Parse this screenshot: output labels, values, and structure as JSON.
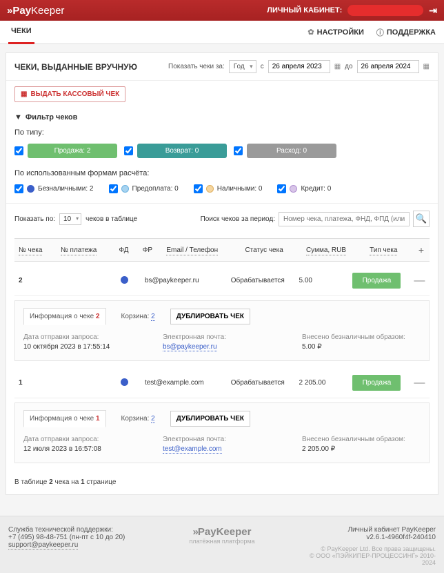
{
  "header": {
    "brand_pay": "Pay",
    "brand_keeper": "Keeper",
    "cabinet_label": "ЛИЧНЫЙ КАБИНЕТ:"
  },
  "nav": {
    "active_tab": "ЧЕКИ",
    "settings": "НАСТРОЙКИ",
    "support": "ПОДДЕРЖКА"
  },
  "titlebar": {
    "title": "ЧЕКИ, ВЫДАННЫЕ ВРУЧНУЮ",
    "show_label": "Показать чеки за:",
    "period": "Год",
    "from_label": "с",
    "from_date": "26 апреля 2023",
    "to_label": "до",
    "to_date": "26 апреля 2024"
  },
  "actions": {
    "issue": "ВЫДАТЬ КАССОВЫЙ ЧЕК"
  },
  "filter": {
    "heading": "Фильтр чеков",
    "by_type": "По типу:",
    "types": [
      {
        "label": "Продажа: 2",
        "cls": "green"
      },
      {
        "label": "Возврат: 0",
        "cls": "teal"
      },
      {
        "label": "Расход: 0",
        "cls": "gray"
      }
    ],
    "by_payment": "По использованным формам расчёта:",
    "payments": [
      {
        "label": "Безналичными: 2",
        "dot": "blue"
      },
      {
        "label": "Предоплата: 0",
        "dot": "lblue"
      },
      {
        "label": "Наличными: 0",
        "dot": "lorange"
      },
      {
        "label": "Кредит: 0",
        "dot": "lpurple"
      }
    ]
  },
  "controls": {
    "show_by": "Показать по:",
    "per_page": "10",
    "in_table": "чеков в таблице",
    "search_label": "Поиск чеков за период:",
    "search_placeholder": "Номер чека, платежа, ФНД, ФПД (или email)"
  },
  "table": {
    "headers": {
      "num": "№ чека",
      "pay": "№ платежа",
      "fd": "ФД",
      "fr": "ФР",
      "email": "Email / Телефон",
      "status": "Статус чека",
      "sum": "Сумма, RUB",
      "type": "Тип чека"
    },
    "rows": [
      {
        "num": "2",
        "email": "bs@paykeeper.ru",
        "status": "Обрабатывается",
        "sum": "5.00",
        "type": "Продажа"
      },
      {
        "num": "1",
        "email": "test@example.com",
        "status": "Обрабатывается",
        "sum": "2 205.00",
        "type": "Продажа"
      }
    ]
  },
  "details": [
    {
      "tab_info": "Информация о чеке",
      "tab_num": "2",
      "tab_cart": "Корзина:",
      "tab_cart_n": "2",
      "dup": "ДУБЛИРОВАТЬ ЧЕК",
      "sent_label": "Дата отправки запроса:",
      "sent_value": "10 октября 2023 в 17:55:14",
      "email_label": "Электронная почта:",
      "email_value": "bs@paykeeper.ru",
      "paid_label": "Внесено безналичным образом:",
      "paid_value": "5.00 ₽"
    },
    {
      "tab_info": "Информация о чеке",
      "tab_num": "1",
      "tab_cart": "Корзина:",
      "tab_cart_n": "2",
      "dup": "ДУБЛИРОВАТЬ ЧЕК",
      "sent_label": "Дата отправки запроса:",
      "sent_value": "12 июля 2023 в 16:57:08",
      "email_label": "Электронная почта:",
      "email_value": "test@example.com",
      "paid_label": "Внесено безналичным образом:",
      "paid_value": "2 205.00 ₽"
    }
  ],
  "pager": {
    "prefix": "В таблице ",
    "count": "2",
    "mid": " чека на ",
    "page": "1",
    "suffix": " странице"
  },
  "footer": {
    "support_title": "Служба технической поддержки:",
    "support_phone": "+7 (495) 98-48-751 (пн-пт с 10 до 20)",
    "support_email": "support@paykeeper.ru",
    "brand_pay": "Pay",
    "brand_keeper": "Keeper",
    "brand_sub": "платёжная платформа",
    "cab": "Личный кабинет PayKeeper",
    "ver": "v2.6.1-4960f4f-240410",
    "copy": "© PayKeeper Ltd. Все права защищены.",
    "legal": "© ООО «ПЭЙКИПЕР-ПРОЦЕССИНГ» 2010-2024"
  }
}
